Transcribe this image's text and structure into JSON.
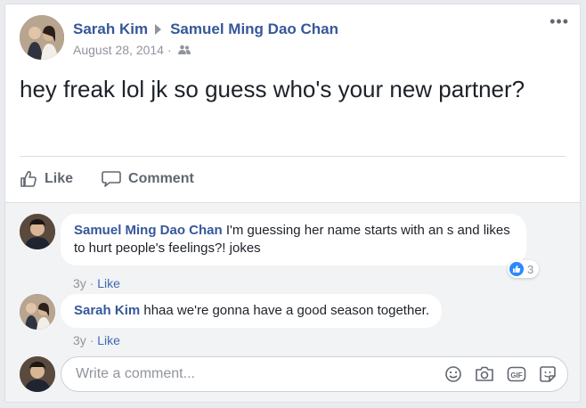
{
  "post": {
    "author": "Sarah Kim",
    "target": "Samuel Ming Dao Chan",
    "date": "August 28, 2014",
    "separator": "·",
    "text": "hey freak lol jk so guess who's your new partner?",
    "more": "•••",
    "audience_icon": "friends-icon"
  },
  "actions": {
    "like_label": "Like",
    "comment_label": "Comment"
  },
  "comments": [
    {
      "author": "Samuel Ming Dao Chan",
      "text": "I'm guessing her name starts with an s and likes to hurt people's feelings?! jokes",
      "time": "3y",
      "like_label": "Like",
      "reaction_count": "3"
    },
    {
      "author": "Sarah Kim",
      "text": "hhaa we're gonna have a good season together.",
      "time": "3y",
      "like_label": "Like"
    }
  ],
  "composer": {
    "placeholder": "Write a comment...",
    "tools": [
      "emoji-icon",
      "camera-icon",
      "gif-icon",
      "sticker-icon"
    ]
  },
  "colors": {
    "link": "#365899",
    "accent": "#4267b2",
    "muted": "#90949c",
    "background": "#e9ebee"
  }
}
